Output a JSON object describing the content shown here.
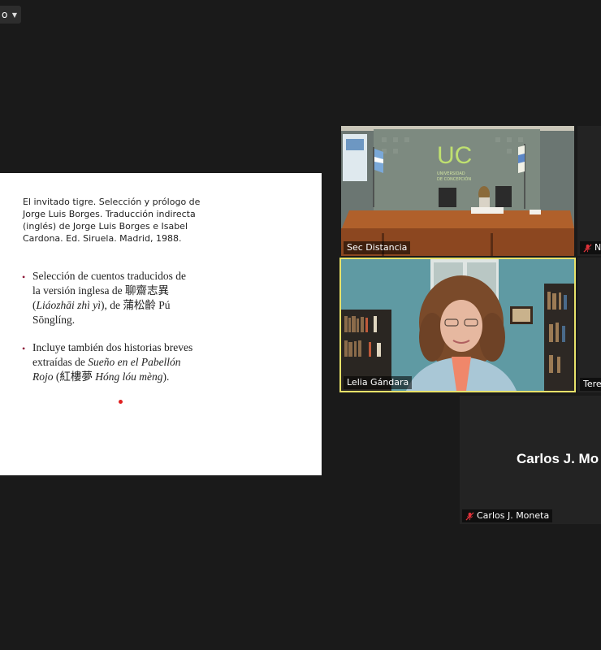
{
  "view_button": {
    "label": "o"
  },
  "slide": {
    "biblio": "El invitado tigre. Selección y prólogo de Jorge Luis Borges. Traducción indirecta (inglés) de Jorge Luis Borges e Isabel Cardona. Ed. Siruela. Madrid, 1988.",
    "bullet1": {
      "part1": "Selección de cuentos traducidos de la versión inglesa de 聊齋志異(",
      "italic": "Liáozhāi zhì yì",
      "part2": "), de 蒲松齡 Pú Sōnglíng."
    },
    "bullet2": {
      "part1": "Incluye también dos historias breves extraídas de ",
      "italic1": "Sueño en el Pabellón Rojo",
      "part2": " (紅樓夢 ",
      "italic2": "Hóng lóu mèng",
      "part3": ")."
    }
  },
  "participants": {
    "sec": {
      "name": "Sec Distancia"
    },
    "lelia": {
      "name": "Lelia Gándara"
    },
    "n": {
      "name": "N"
    },
    "teres": {
      "name": "Teres"
    },
    "carlos": {
      "name": "Carlos J. Moneta",
      "big_name": "Carlos J. Mo"
    }
  },
  "room_sign": {
    "logo": "UC",
    "caption_line1": "UNIVERSIDAD",
    "caption_line2": "DE CONCEPCIÓN"
  },
  "colors": {
    "active_speaker_border": "#e8e26a",
    "mute_red": "#e0323a"
  }
}
